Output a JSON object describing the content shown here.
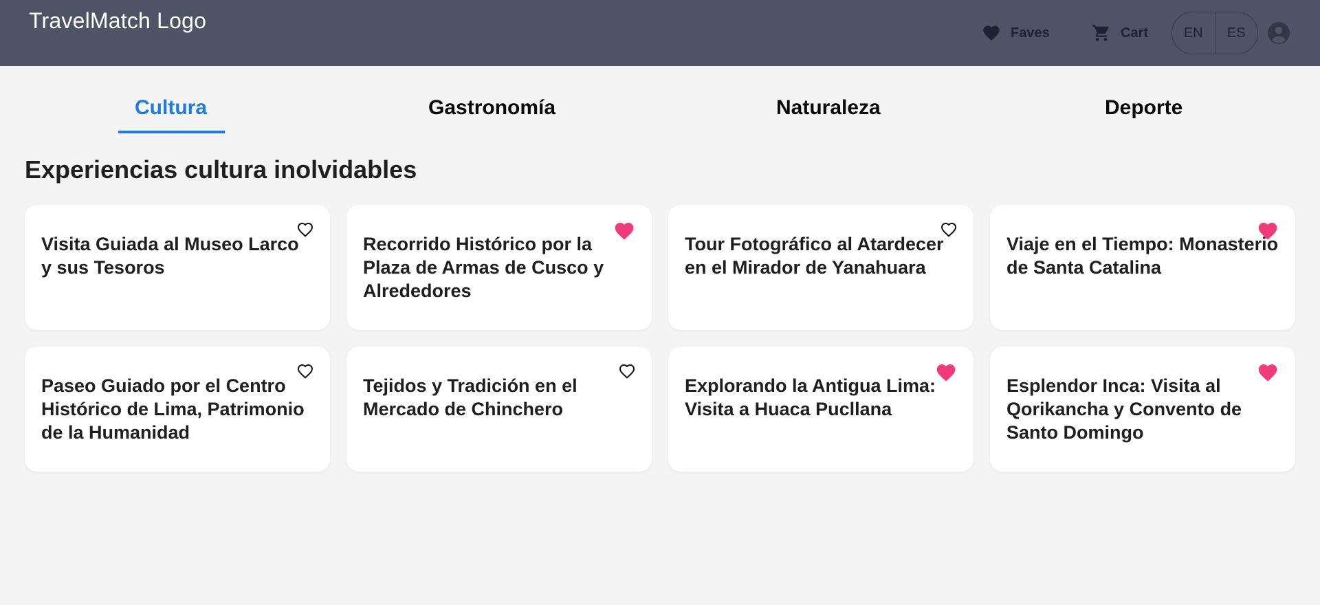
{
  "header": {
    "brand": "TravelMatch Logo",
    "faves_label": "Faves",
    "cart_label": "Cart",
    "languages": [
      "EN",
      "ES"
    ],
    "icons": {
      "faves": "heart-icon",
      "cart": "cart-icon",
      "account": "account-icon"
    }
  },
  "tabs": [
    {
      "label": "Cultura",
      "active": true
    },
    {
      "label": "Gastronomía",
      "active": false
    },
    {
      "label": "Naturaleza",
      "active": false
    },
    {
      "label": "Deporte",
      "active": false
    }
  ],
  "section_title": "Experiencias cultura inolvidables",
  "colors": {
    "header_bg": "#4e5366",
    "accent": "#1e7be0",
    "favorite": "#f03a79",
    "page_bg": "#f4f4f4"
  },
  "cards": [
    {
      "title": "Visita Guiada al Museo Larco y sus Tesoros",
      "favorite": false
    },
    {
      "title": "Recorrido Histórico por la Plaza de Armas de Cusco y Alrededores",
      "favorite": true
    },
    {
      "title": "Tour Fotográfico al Atardecer en el Mirador de Yanahuara",
      "favorite": false
    },
    {
      "title": "Viaje en el Tiempo: Monasterio de Santa Catalina",
      "favorite": true
    },
    {
      "title": "Paseo Guiado por el Centro Histórico de Lima, Patrimonio de la Humanidad",
      "favorite": false
    },
    {
      "title": "Tejidos y Tradición en el Mercado de Chinchero",
      "favorite": false
    },
    {
      "title": "Explorando la Antigua Lima: Visita a Huaca Pucllana",
      "favorite": true
    },
    {
      "title": "Esplendor Inca: Visita al Qorikancha y Convento de Santo Domingo",
      "favorite": true
    }
  ]
}
